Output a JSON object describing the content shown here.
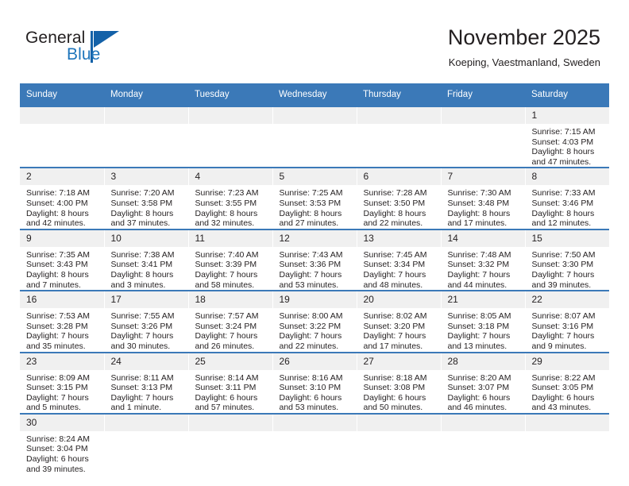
{
  "brand": {
    "name_top": "General",
    "name_bottom": "Blue",
    "top_color": "#231f20",
    "bottom_color": "#1e75bb",
    "triangle_color": "#1361a8"
  },
  "header": {
    "title": "November 2025",
    "subtitle": "Koeping, Vaestmanland, Sweden"
  },
  "theme": {
    "header_bg": "#3b79b8",
    "header_text": "#ffffff",
    "daynum_bg": "#f0f0f0",
    "row_border": "#3b79b8",
    "text": "#231f20"
  },
  "weekdays": [
    "Sunday",
    "Monday",
    "Tuesday",
    "Wednesday",
    "Thursday",
    "Friday",
    "Saturday"
  ],
  "labels": {
    "sunrise_prefix": "Sunrise:",
    "sunset_prefix": "Sunset:",
    "daylight_prefix": "Daylight:"
  },
  "weeks": [
    [
      {
        "day": "",
        "empty": true,
        "l1": "",
        "l2": "",
        "l3": "",
        "l4": ""
      },
      {
        "day": "",
        "empty": true,
        "l1": "",
        "l2": "",
        "l3": "",
        "l4": ""
      },
      {
        "day": "",
        "empty": true,
        "l1": "",
        "l2": "",
        "l3": "",
        "l4": ""
      },
      {
        "day": "",
        "empty": true,
        "l1": "",
        "l2": "",
        "l3": "",
        "l4": ""
      },
      {
        "day": "",
        "empty": true,
        "l1": "",
        "l2": "",
        "l3": "",
        "l4": ""
      },
      {
        "day": "",
        "empty": true,
        "l1": "",
        "l2": "",
        "l3": "",
        "l4": ""
      },
      {
        "day": "1",
        "empty": false,
        "l1": "Sunrise: 7:15 AM",
        "l2": "Sunset: 4:03 PM",
        "l3": "Daylight: 8 hours",
        "l4": "and 47 minutes."
      }
    ],
    [
      {
        "day": "2",
        "empty": false,
        "l1": "Sunrise: 7:18 AM",
        "l2": "Sunset: 4:00 PM",
        "l3": "Daylight: 8 hours",
        "l4": "and 42 minutes."
      },
      {
        "day": "3",
        "empty": false,
        "l1": "Sunrise: 7:20 AM",
        "l2": "Sunset: 3:58 PM",
        "l3": "Daylight: 8 hours",
        "l4": "and 37 minutes."
      },
      {
        "day": "4",
        "empty": false,
        "l1": "Sunrise: 7:23 AM",
        "l2": "Sunset: 3:55 PM",
        "l3": "Daylight: 8 hours",
        "l4": "and 32 minutes."
      },
      {
        "day": "5",
        "empty": false,
        "l1": "Sunrise: 7:25 AM",
        "l2": "Sunset: 3:53 PM",
        "l3": "Daylight: 8 hours",
        "l4": "and 27 minutes."
      },
      {
        "day": "6",
        "empty": false,
        "l1": "Sunrise: 7:28 AM",
        "l2": "Sunset: 3:50 PM",
        "l3": "Daylight: 8 hours",
        "l4": "and 22 minutes."
      },
      {
        "day": "7",
        "empty": false,
        "l1": "Sunrise: 7:30 AM",
        "l2": "Sunset: 3:48 PM",
        "l3": "Daylight: 8 hours",
        "l4": "and 17 minutes."
      },
      {
        "day": "8",
        "empty": false,
        "l1": "Sunrise: 7:33 AM",
        "l2": "Sunset: 3:46 PM",
        "l3": "Daylight: 8 hours",
        "l4": "and 12 minutes."
      }
    ],
    [
      {
        "day": "9",
        "empty": false,
        "l1": "Sunrise: 7:35 AM",
        "l2": "Sunset: 3:43 PM",
        "l3": "Daylight: 8 hours",
        "l4": "and 7 minutes."
      },
      {
        "day": "10",
        "empty": false,
        "l1": "Sunrise: 7:38 AM",
        "l2": "Sunset: 3:41 PM",
        "l3": "Daylight: 8 hours",
        "l4": "and 3 minutes."
      },
      {
        "day": "11",
        "empty": false,
        "l1": "Sunrise: 7:40 AM",
        "l2": "Sunset: 3:39 PM",
        "l3": "Daylight: 7 hours",
        "l4": "and 58 minutes."
      },
      {
        "day": "12",
        "empty": false,
        "l1": "Sunrise: 7:43 AM",
        "l2": "Sunset: 3:36 PM",
        "l3": "Daylight: 7 hours",
        "l4": "and 53 minutes."
      },
      {
        "day": "13",
        "empty": false,
        "l1": "Sunrise: 7:45 AM",
        "l2": "Sunset: 3:34 PM",
        "l3": "Daylight: 7 hours",
        "l4": "and 48 minutes."
      },
      {
        "day": "14",
        "empty": false,
        "l1": "Sunrise: 7:48 AM",
        "l2": "Sunset: 3:32 PM",
        "l3": "Daylight: 7 hours",
        "l4": "and 44 minutes."
      },
      {
        "day": "15",
        "empty": false,
        "l1": "Sunrise: 7:50 AM",
        "l2": "Sunset: 3:30 PM",
        "l3": "Daylight: 7 hours",
        "l4": "and 39 minutes."
      }
    ],
    [
      {
        "day": "16",
        "empty": false,
        "l1": "Sunrise: 7:53 AM",
        "l2": "Sunset: 3:28 PM",
        "l3": "Daylight: 7 hours",
        "l4": "and 35 minutes."
      },
      {
        "day": "17",
        "empty": false,
        "l1": "Sunrise: 7:55 AM",
        "l2": "Sunset: 3:26 PM",
        "l3": "Daylight: 7 hours",
        "l4": "and 30 minutes."
      },
      {
        "day": "18",
        "empty": false,
        "l1": "Sunrise: 7:57 AM",
        "l2": "Sunset: 3:24 PM",
        "l3": "Daylight: 7 hours",
        "l4": "and 26 minutes."
      },
      {
        "day": "19",
        "empty": false,
        "l1": "Sunrise: 8:00 AM",
        "l2": "Sunset: 3:22 PM",
        "l3": "Daylight: 7 hours",
        "l4": "and 22 minutes."
      },
      {
        "day": "20",
        "empty": false,
        "l1": "Sunrise: 8:02 AM",
        "l2": "Sunset: 3:20 PM",
        "l3": "Daylight: 7 hours",
        "l4": "and 17 minutes."
      },
      {
        "day": "21",
        "empty": false,
        "l1": "Sunrise: 8:05 AM",
        "l2": "Sunset: 3:18 PM",
        "l3": "Daylight: 7 hours",
        "l4": "and 13 minutes."
      },
      {
        "day": "22",
        "empty": false,
        "l1": "Sunrise: 8:07 AM",
        "l2": "Sunset: 3:16 PM",
        "l3": "Daylight: 7 hours",
        "l4": "and 9 minutes."
      }
    ],
    [
      {
        "day": "23",
        "empty": false,
        "l1": "Sunrise: 8:09 AM",
        "l2": "Sunset: 3:15 PM",
        "l3": "Daylight: 7 hours",
        "l4": "and 5 minutes."
      },
      {
        "day": "24",
        "empty": false,
        "l1": "Sunrise: 8:11 AM",
        "l2": "Sunset: 3:13 PM",
        "l3": "Daylight: 7 hours",
        "l4": "and 1 minute."
      },
      {
        "day": "25",
        "empty": false,
        "l1": "Sunrise: 8:14 AM",
        "l2": "Sunset: 3:11 PM",
        "l3": "Daylight: 6 hours",
        "l4": "and 57 minutes."
      },
      {
        "day": "26",
        "empty": false,
        "l1": "Sunrise: 8:16 AM",
        "l2": "Sunset: 3:10 PM",
        "l3": "Daylight: 6 hours",
        "l4": "and 53 minutes."
      },
      {
        "day": "27",
        "empty": false,
        "l1": "Sunrise: 8:18 AM",
        "l2": "Sunset: 3:08 PM",
        "l3": "Daylight: 6 hours",
        "l4": "and 50 minutes."
      },
      {
        "day": "28",
        "empty": false,
        "l1": "Sunrise: 8:20 AM",
        "l2": "Sunset: 3:07 PM",
        "l3": "Daylight: 6 hours",
        "l4": "and 46 minutes."
      },
      {
        "day": "29",
        "empty": false,
        "l1": "Sunrise: 8:22 AM",
        "l2": "Sunset: 3:05 PM",
        "l3": "Daylight: 6 hours",
        "l4": "and 43 minutes."
      }
    ],
    [
      {
        "day": "30",
        "empty": false,
        "l1": "Sunrise: 8:24 AM",
        "l2": "Sunset: 3:04 PM",
        "l3": "Daylight: 6 hours",
        "l4": "and 39 minutes."
      },
      {
        "day": "",
        "empty": true,
        "l1": "",
        "l2": "",
        "l3": "",
        "l4": ""
      },
      {
        "day": "",
        "empty": true,
        "l1": "",
        "l2": "",
        "l3": "",
        "l4": ""
      },
      {
        "day": "",
        "empty": true,
        "l1": "",
        "l2": "",
        "l3": "",
        "l4": ""
      },
      {
        "day": "",
        "empty": true,
        "l1": "",
        "l2": "",
        "l3": "",
        "l4": ""
      },
      {
        "day": "",
        "empty": true,
        "l1": "",
        "l2": "",
        "l3": "",
        "l4": ""
      },
      {
        "day": "",
        "empty": true,
        "l1": "",
        "l2": "",
        "l3": "",
        "l4": ""
      }
    ]
  ]
}
